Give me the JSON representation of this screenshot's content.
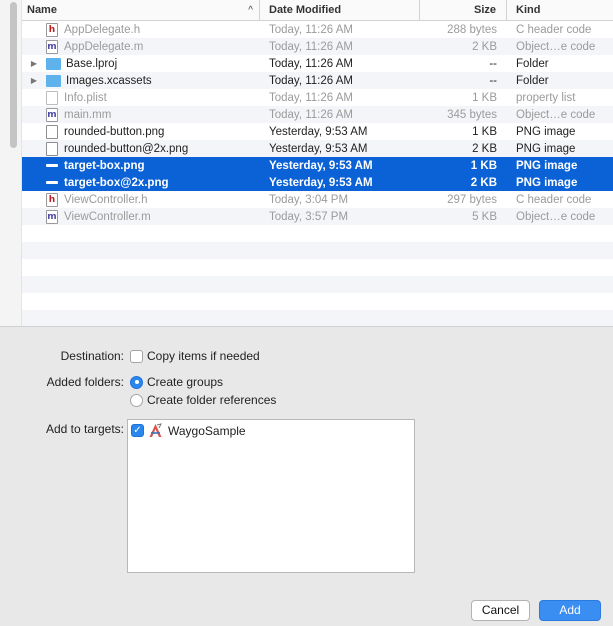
{
  "columns": {
    "name": "Name",
    "sort_indicator": "^",
    "date": "Date Modified",
    "size": "Size",
    "kind": "Kind"
  },
  "files": [
    {
      "name": "AppDelegate.h",
      "date": "Today, 11:26 AM",
      "size": "288 bytes",
      "kind": "C header code",
      "icon": "h",
      "dim": true,
      "selected": false,
      "folder": false
    },
    {
      "name": "AppDelegate.m",
      "date": "Today, 11:26 AM",
      "size": "2 KB",
      "kind": "Object…e code",
      "icon": "m",
      "dim": true,
      "selected": false,
      "folder": false
    },
    {
      "name": "Base.lproj",
      "date": "Today, 11:26 AM",
      "size": "--",
      "kind": "Folder",
      "icon": "folder",
      "dim": false,
      "selected": false,
      "folder": true
    },
    {
      "name": "Images.xcassets",
      "date": "Today, 11:26 AM",
      "size": "--",
      "kind": "Folder",
      "icon": "folder",
      "dim": false,
      "selected": false,
      "folder": true
    },
    {
      "name": "Info.plist",
      "date": "Today, 11:26 AM",
      "size": "1 KB",
      "kind": "property list",
      "icon": "plist",
      "dim": true,
      "selected": false,
      "folder": false
    },
    {
      "name": "main.mm",
      "date": "Today, 11:26 AM",
      "size": "345 bytes",
      "kind": "Object…e code",
      "icon": "m",
      "dim": true,
      "selected": false,
      "folder": false
    },
    {
      "name": "rounded-button.png",
      "date": "Yesterday, 9:53 AM",
      "size": "1 KB",
      "kind": "PNG image",
      "icon": "png",
      "dim": false,
      "selected": false,
      "folder": false
    },
    {
      "name": "rounded-button@2x.png",
      "date": "Yesterday, 9:53 AM",
      "size": "2 KB",
      "kind": "PNG image",
      "icon": "png",
      "dim": false,
      "selected": false,
      "folder": false
    },
    {
      "name": "target-box.png",
      "date": "Yesterday, 9:53 AM",
      "size": "1 KB",
      "kind": "PNG image",
      "icon": "png",
      "dim": false,
      "selected": true,
      "folder": false
    },
    {
      "name": "target-box@2x.png",
      "date": "Yesterday, 9:53 AM",
      "size": "2 KB",
      "kind": "PNG image",
      "icon": "png",
      "dim": false,
      "selected": true,
      "folder": false
    },
    {
      "name": "ViewController.h",
      "date": "Today, 3:04 PM",
      "size": "297 bytes",
      "kind": "C header code",
      "icon": "h",
      "dim": true,
      "selected": false,
      "folder": false
    },
    {
      "name": "ViewController.m",
      "date": "Today, 3:57 PM",
      "size": "5 KB",
      "kind": "Object…e code",
      "icon": "m",
      "dim": true,
      "selected": false,
      "folder": false
    }
  ],
  "empty_rows": 6,
  "options": {
    "destination_label": "Destination:",
    "copy_items": {
      "label": "Copy items if needed",
      "checked": false
    },
    "added_folders_label": "Added folders:",
    "create_groups": {
      "label": "Create groups",
      "selected": true
    },
    "create_folder_refs": {
      "label": "Create folder references",
      "selected": false
    },
    "targets_label": "Add to targets:",
    "target": {
      "name": "WaygoSample",
      "checked": true
    }
  },
  "buttons": {
    "cancel": "Cancel",
    "add": "Add"
  },
  "icons": {
    "h_letter": "h",
    "m_letter": "m",
    "check": "✓",
    "disclosure": "▶"
  },
  "colors": {
    "selection": "#0b62d6",
    "accent": "#3a8df1",
    "folder": "#5fb3ec"
  }
}
